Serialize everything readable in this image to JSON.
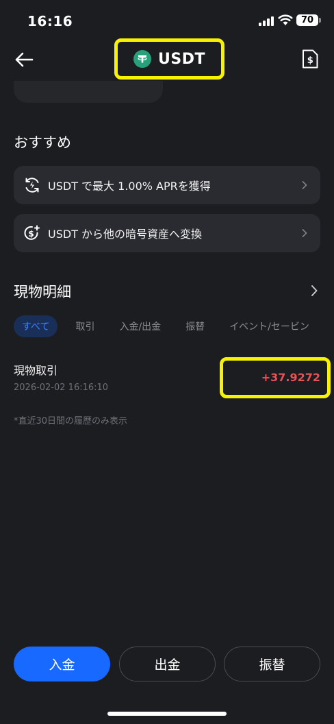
{
  "status_bar": {
    "time": "16:16",
    "battery": "70"
  },
  "header": {
    "title": "USDT",
    "icon": "tether-icon"
  },
  "recommend": {
    "title": "おすすめ",
    "items": [
      {
        "label": "USDT で最大 1.00% APRを獲得",
        "icon": "earn-cycle-icon"
      },
      {
        "label": "USDT から他の暗号資産へ変換",
        "icon": "convert-coin-icon"
      }
    ]
  },
  "spot_details": {
    "title": "現物明細",
    "tabs": [
      "すべて",
      "取引",
      "入金/出金",
      "振替",
      "イベント/セービン"
    ],
    "active_tab": "すべて",
    "transactions": [
      {
        "title": "現物取引",
        "datetime": "2026-02-02 16:16:10",
        "amount": "+37.9272"
      }
    ],
    "note": "*直近30日間の履歴のみ表示"
  },
  "actions": {
    "deposit": "入金",
    "withdraw": "出金",
    "transfer": "振替"
  },
  "colors": {
    "accent": "#1769ff",
    "negative_amount": "#e45457",
    "tether": "#27a17a",
    "highlight": "#f7f200"
  }
}
